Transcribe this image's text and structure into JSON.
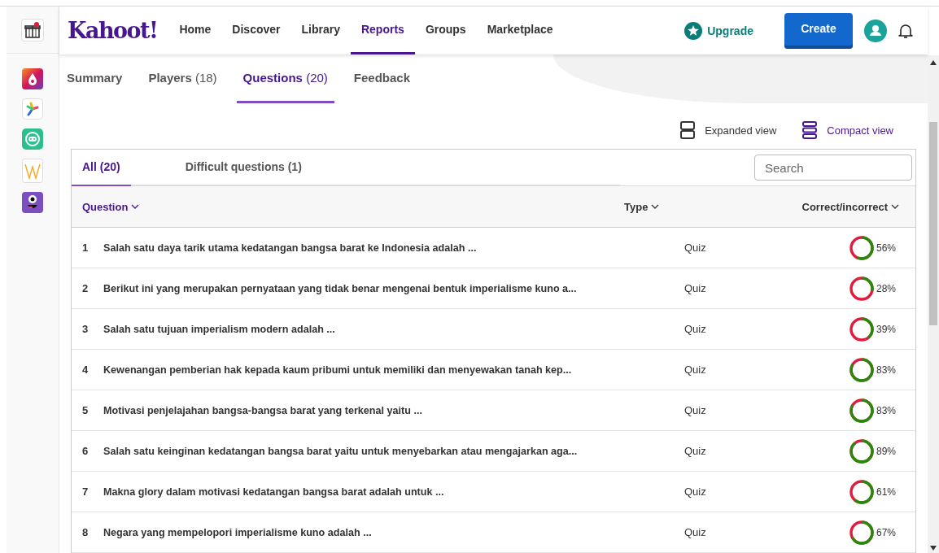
{
  "logo": "Kahoot!",
  "nav": [
    {
      "label": "Home",
      "selected": false
    },
    {
      "label": "Discover",
      "selected": false
    },
    {
      "label": "Library",
      "selected": false
    },
    {
      "label": "Reports",
      "selected": true
    },
    {
      "label": "Groups",
      "selected": false
    },
    {
      "label": "Marketplace",
      "selected": false
    }
  ],
  "upgrade": "Upgrade",
  "create": "Create",
  "report_tabs": [
    {
      "label": "Summary",
      "selected": false
    },
    {
      "label": "Players",
      "count": "(18)",
      "selected": false
    },
    {
      "label": "Questions",
      "count": "(20)",
      "selected": true
    },
    {
      "label": "Feedback",
      "selected": false
    }
  ],
  "views": [
    {
      "label": "Expanded view",
      "selected": false
    },
    {
      "label": "Compact view",
      "selected": true
    }
  ],
  "filter_tabs": [
    {
      "label": "All (20)",
      "selected": true
    },
    {
      "label": "Difficult questions (1)",
      "selected": false
    }
  ],
  "search": {
    "placeholder": "Search"
  },
  "table": {
    "columns": [
      "Question",
      "Type",
      "Correct/incorrect"
    ],
    "rows": [
      {
        "number": "1",
        "question": "Salah satu daya tarik utama kedatangan bangsa barat ke Indonesia adalah ...",
        "type": "Quiz",
        "percent": "56%"
      },
      {
        "number": "2",
        "question": "Berikut ini yang merupakan pernyataan yang tidak benar mengenai bentuk imperialisme kuno a...",
        "type": "Quiz",
        "percent": "28%"
      },
      {
        "number": "3",
        "question": "Salah satu tujuan imperialism modern adalah ...",
        "type": "Quiz",
        "percent": "39%"
      },
      {
        "number": "4",
        "question": "Kewenangan pemberian hak kepada kaum pribumi untuk memiliki dan menyewakan tanah kep...",
        "type": "Quiz",
        "percent": "83%"
      },
      {
        "number": "5",
        "question": "Motivasi penjelajahan bangsa-bangsa barat yang terkenal yaitu ...",
        "type": "Quiz",
        "percent": "83%"
      },
      {
        "number": "6",
        "question": "Salah satu keinginan kedatangan bangsa barat yaitu untuk menyebarkan atau mengajarkan aga...",
        "type": "Quiz",
        "percent": "89%"
      },
      {
        "number": "7",
        "question": "Makna glory dalam motivasi kedatangan bangsa barat adalah untuk ...",
        "type": "Quiz",
        "percent": "61%"
      },
      {
        "number": "8",
        "question": "Negara yang mempelopori imperialisme kuno adalah ...",
        "type": "Quiz",
        "percent": "67%"
      }
    ]
  }
}
